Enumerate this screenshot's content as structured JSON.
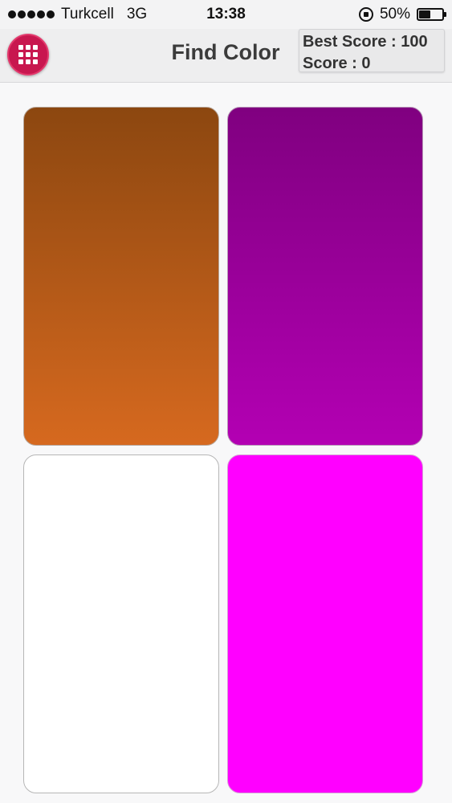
{
  "status_bar": {
    "carrier": "Turkcell",
    "network": "3G",
    "time": "13:38",
    "battery": "50%",
    "battery_level": 0.5,
    "icons": [
      "signal-dots-icon",
      "rotation-lock-icon",
      "battery-icon"
    ]
  },
  "header": {
    "title": "Find Color",
    "best_score_text": "Best Score : 100",
    "score_text": "Score : 0",
    "menu_icon": "grid-icon",
    "menu_color": "#c8174f"
  },
  "tiles": [
    {
      "top_color": "#8c4710",
      "bottom_color": "#d6691f",
      "border_color": "#b7a69a"
    },
    {
      "top_color": "#800080",
      "bottom_color": "#b300b3",
      "border_color": "#b89ab8"
    },
    {
      "top_color": "#ffffff",
      "bottom_color": "#ffffff",
      "border_color": "#b6b6b6"
    },
    {
      "top_color": "#ff00ff",
      "bottom_color": "#ff00ff",
      "border_color": "#d79fd7"
    }
  ]
}
